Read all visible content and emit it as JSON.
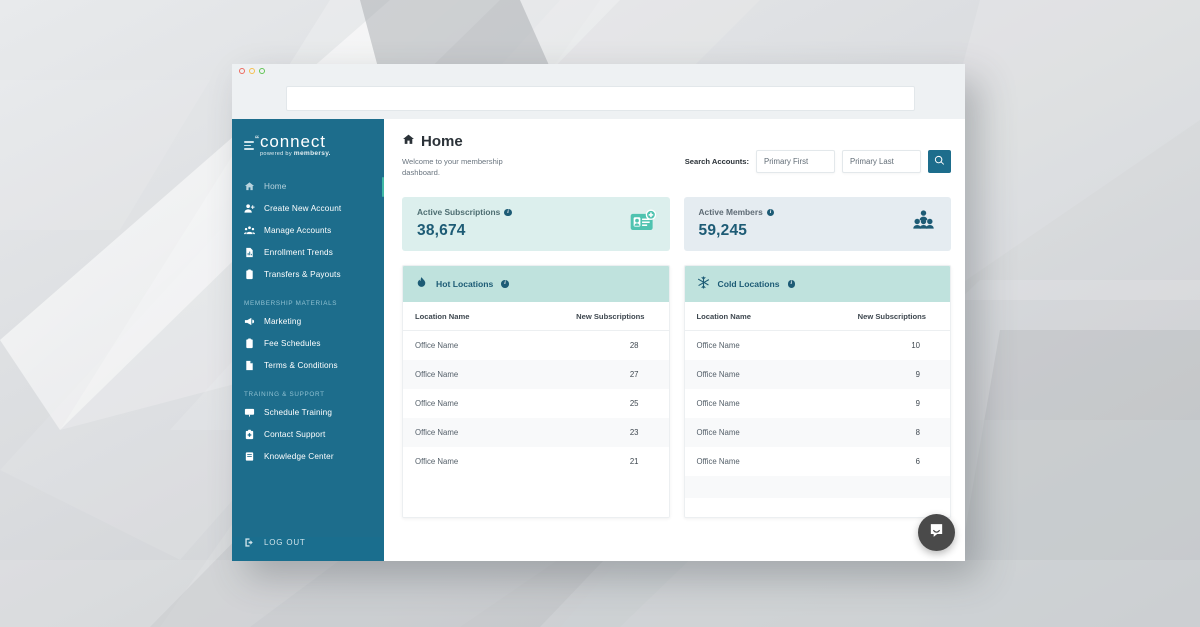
{
  "browser": {
    "traffic_lights": [
      "red",
      "yellow",
      "green"
    ],
    "url_value": "",
    "url_placeholder": ""
  },
  "sidebar": {
    "logo": {
      "mark": "hamburger-icon",
      "name": "connect",
      "tagline_prefix": "powered by",
      "tagline_brand": "membersy."
    },
    "items": [
      {
        "label": "Home",
        "icon": "home-icon",
        "active": true
      },
      {
        "label": "Create New Account",
        "icon": "user-plus-icon",
        "active": false
      },
      {
        "label": "Manage Accounts",
        "icon": "users-icon",
        "active": false
      },
      {
        "label": "Enrollment Trends",
        "icon": "document-chart-icon",
        "active": false
      },
      {
        "label": "Transfers & Payouts",
        "icon": "clipboard-icon",
        "active": false
      }
    ],
    "section_materials": "MEMBERSHIP MATERIALS",
    "materials": [
      {
        "label": "Marketing",
        "icon": "megaphone-icon"
      },
      {
        "label": "Fee Schedules",
        "icon": "clipboard-icon"
      },
      {
        "label": "Terms & Conditions",
        "icon": "document-icon"
      }
    ],
    "section_training": "TRAINING & SUPPORT",
    "training": [
      {
        "label": "Schedule Training",
        "icon": "presentation-icon"
      },
      {
        "label": "Contact Support",
        "icon": "support-badge-icon"
      },
      {
        "label": "Knowledge Center",
        "icon": "book-icon"
      }
    ],
    "logout": {
      "label": "LOG OUT",
      "icon": "logout-icon"
    },
    "colors": {
      "background": "#1d6d8c",
      "accent": "#3fb8a6",
      "active_text": "#b9d4de"
    }
  },
  "header": {
    "title": "Home",
    "title_icon": "home-icon",
    "subtitle": "Welcome to your membership dashboard."
  },
  "search": {
    "label": "Search Accounts:",
    "first_value": "Primary First",
    "first_placeholder": "Primary First",
    "last_value": "Primary Last",
    "last_placeholder": "Primary Last",
    "button_icon": "search-icon"
  },
  "stats": [
    {
      "label": "Active Subscriptions",
      "value": "38,674",
      "icon": "id-card-plus-icon",
      "info": "i",
      "bg": "#dcefed"
    },
    {
      "label": "Active Members",
      "value": "59,245",
      "icon": "people-group-icon",
      "info": "i",
      "bg": "#e5ecf1"
    }
  ],
  "panels": [
    {
      "title": "Hot Locations",
      "icon": "flame-icon",
      "info": "i",
      "columns": [
        "Location Name",
        "New Subscriptions"
      ],
      "rows": [
        {
          "name": "Office Name",
          "value": "28"
        },
        {
          "name": "Office Name",
          "value": "27"
        },
        {
          "name": "Office Name",
          "value": "25"
        },
        {
          "name": "Office Name",
          "value": "23"
        },
        {
          "name": "Office Name",
          "value": "21"
        }
      ]
    },
    {
      "title": "Cold Locations",
      "icon": "snowflake-icon",
      "info": "i",
      "columns": [
        "Location Name",
        "New Subscriptions"
      ],
      "rows": [
        {
          "name": "Office Name",
          "value": "10"
        },
        {
          "name": "Office Name",
          "value": "9"
        },
        {
          "name": "Office Name",
          "value": "9"
        },
        {
          "name": "Office Name",
          "value": "8"
        },
        {
          "name": "Office Name",
          "value": "6"
        }
      ]
    }
  ],
  "chat_widget": {
    "icon": "chat-bubble-icon"
  }
}
